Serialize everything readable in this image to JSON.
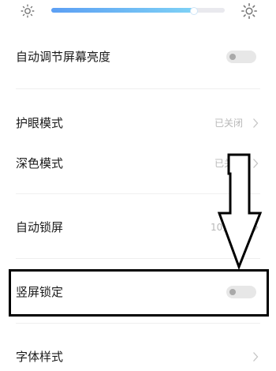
{
  "brightness": {
    "icon_left": "dim-sun-icon",
    "icon_right": "bright-sun-icon",
    "level": 0.82,
    "accent_start": "#5c9ff4",
    "accent_end": "#7ed1f5"
  },
  "settings": {
    "auto_brightness": {
      "label": "自动调节屏幕亮度",
      "enabled": false
    },
    "eye_care": {
      "label": "护眼模式",
      "value": "已关闭"
    },
    "dark_mode": {
      "label": "深色模式",
      "value": "已关闭"
    },
    "auto_lock": {
      "label": "自动锁屏",
      "value": "10分钟"
    },
    "portrait_lock": {
      "label": "竖屏锁定",
      "enabled": false
    },
    "font_style": {
      "label": "字体样式"
    }
  },
  "annotation": {
    "arrow": "down-arrow-icon",
    "highlight": "highlight-box"
  }
}
